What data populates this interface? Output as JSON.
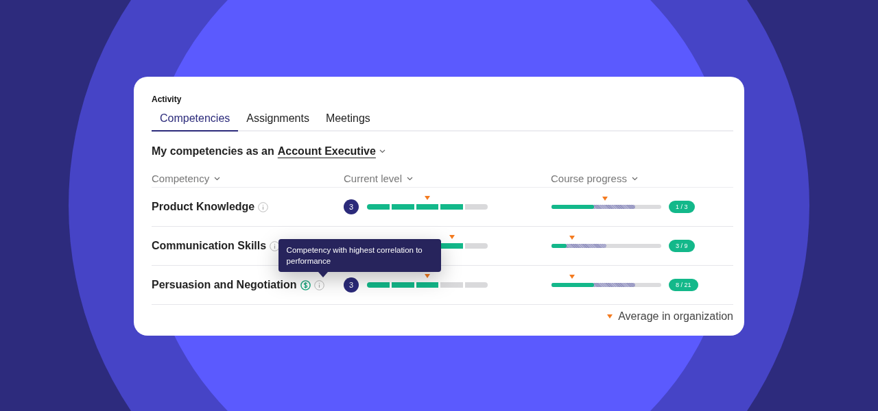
{
  "card": {
    "title": "Activity",
    "tabs": [
      {
        "label": "Competencies",
        "selected": true
      },
      {
        "label": "Assignments",
        "selected": false
      },
      {
        "label": "Meetings",
        "selected": false
      }
    ],
    "heading": {
      "prefix": "My competencies as an",
      "role": "Account Executive"
    },
    "columns": [
      {
        "label": "Competency"
      },
      {
        "label": "Current level"
      },
      {
        "label": "Course progress"
      }
    ],
    "rows": [
      {
        "name": "Product Knowledge",
        "top_correlation": false,
        "badge": "3",
        "segments": [
          {
            "filled": true,
            "average": false
          },
          {
            "filled": true,
            "average": false
          },
          {
            "filled": true,
            "average": true
          },
          {
            "filled": true,
            "average": false
          },
          {
            "filled": false,
            "average": false
          }
        ],
        "completed": {
          "level": 0.39
        },
        "in_progress": {
          "level": 0.76
        },
        "progress_average": {
          "level": 0.49
        },
        "count": "1 / 3"
      },
      {
        "name": "Communication Skills",
        "top_correlation": false,
        "segments": [
          {
            "filled": true,
            "average": true
          },
          {
            "filled": false,
            "average": false
          }
        ],
        "completed": {
          "level": 0.14
        },
        "in_progress": {
          "level": 0.5
        },
        "progress_average": {
          "level": 0.19
        },
        "count": "3 / 9"
      },
      {
        "name": "Persuasion and Negotiation",
        "top_correlation": true,
        "badge": "3",
        "segments": [
          {
            "filled": true,
            "average": false
          },
          {
            "filled": true,
            "average": false
          },
          {
            "filled": true,
            "average": true
          },
          {
            "filled": false,
            "average": false
          },
          {
            "filled": false,
            "average": false
          }
        ],
        "completed": {
          "level": 0.39
        },
        "in_progress": {
          "level": 0.76
        },
        "progress_average": {
          "level": 0.19
        },
        "count": "8 / 21",
        "tooltip": "Competency with highest correlation to performance"
      }
    ],
    "legend": "Average in organization"
  }
}
